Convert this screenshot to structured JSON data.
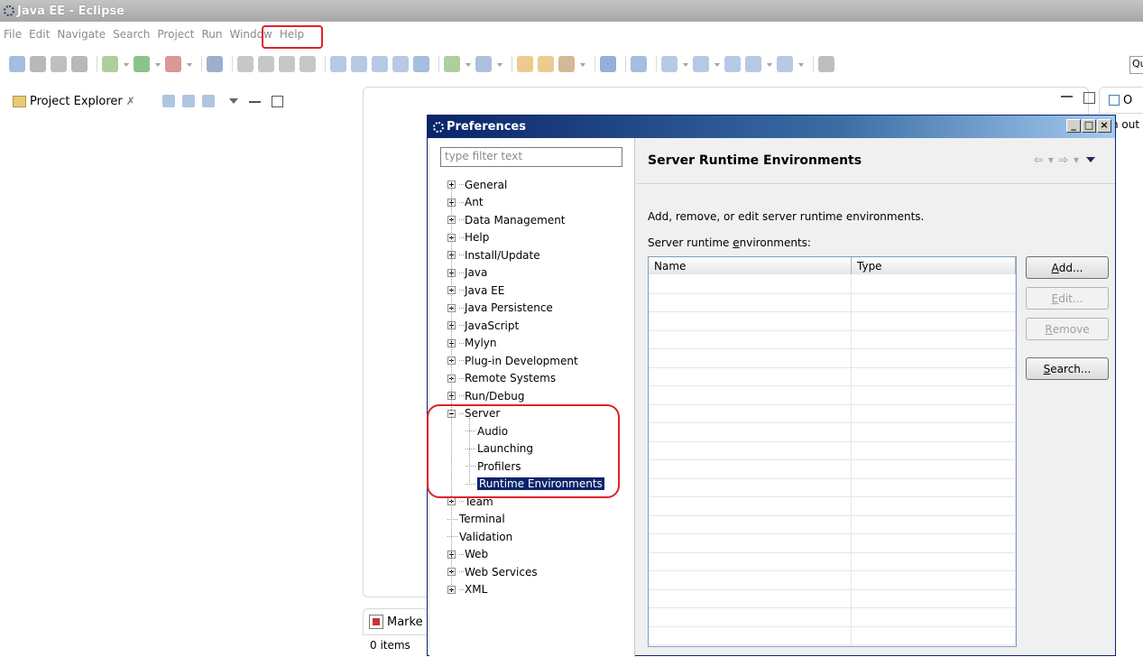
{
  "window": {
    "title": "Java EE - Eclipse"
  },
  "menubar": {
    "items": [
      "File",
      "Edit",
      "Navigate",
      "Search",
      "Project",
      "Run",
      "Window",
      "Help"
    ]
  },
  "quick_access": {
    "text": "Qu"
  },
  "project_explorer": {
    "title": "Project Explorer",
    "close_glyph": "✗"
  },
  "outline": {
    "title": "O",
    "note": "n out"
  },
  "markers": {
    "title": "Marke",
    "count": "0 items"
  },
  "preferences": {
    "title": "Preferences",
    "filter_placeholder": "type filter text",
    "tree": [
      {
        "label": "General",
        "state": "collapsed",
        "level": 0
      },
      {
        "label": "Ant",
        "state": "collapsed",
        "level": 0
      },
      {
        "label": "Data Management",
        "state": "collapsed",
        "level": 0
      },
      {
        "label": "Help",
        "state": "collapsed",
        "level": 0
      },
      {
        "label": "Install/Update",
        "state": "collapsed",
        "level": 0
      },
      {
        "label": "Java",
        "state": "collapsed",
        "level": 0
      },
      {
        "label": "Java EE",
        "state": "collapsed",
        "level": 0
      },
      {
        "label": "Java Persistence",
        "state": "collapsed",
        "level": 0
      },
      {
        "label": "JavaScript",
        "state": "collapsed",
        "level": 0
      },
      {
        "label": "Mylyn",
        "state": "collapsed",
        "level": 0
      },
      {
        "label": "Plug-in Development",
        "state": "collapsed",
        "level": 0
      },
      {
        "label": "Remote Systems",
        "state": "collapsed",
        "level": 0
      },
      {
        "label": "Run/Debug",
        "state": "collapsed",
        "level": 0
      },
      {
        "label": "Server",
        "state": "expanded",
        "level": 0
      },
      {
        "label": "Audio",
        "state": "leaf",
        "level": 1
      },
      {
        "label": "Launching",
        "state": "leaf",
        "level": 1
      },
      {
        "label": "Profilers",
        "state": "leaf",
        "level": 1
      },
      {
        "label": "Runtime Environments",
        "state": "leaf",
        "level": 1,
        "selected": true
      },
      {
        "label": "Team",
        "state": "collapsed",
        "level": 0
      },
      {
        "label": "Terminal",
        "state": "leaf",
        "level": 0
      },
      {
        "label": "Validation",
        "state": "leaf",
        "level": 0
      },
      {
        "label": "Web",
        "state": "collapsed",
        "level": 0
      },
      {
        "label": "Web Services",
        "state": "collapsed",
        "level": 0
      },
      {
        "label": "XML",
        "state": "collapsed",
        "level": 0
      }
    ],
    "page": {
      "title": "Server Runtime Environments",
      "description": "Add, remove, or edit server runtime environments.",
      "envs_label_pre": "Server runtime ",
      "envs_label_mn": "e",
      "envs_label_post": "nvironments:",
      "columns": [
        "Name",
        "Type"
      ],
      "row_count": 20,
      "buttons": [
        {
          "label": "Add...",
          "mnemonic": "A",
          "rest": "dd...",
          "enabled": true
        },
        {
          "label": "Edit...",
          "mnemonic": "E",
          "rest": "dit...",
          "enabled": false
        },
        {
          "label": "Remove",
          "mnemonic": "R",
          "rest": "emove",
          "enabled": false
        },
        {
          "label": "Search...",
          "mnemonic": "S",
          "rest": "earch...",
          "enabled": true
        }
      ]
    }
  },
  "colors": {
    "selection": "#0a246a",
    "annotation_red": "#e0212b"
  }
}
